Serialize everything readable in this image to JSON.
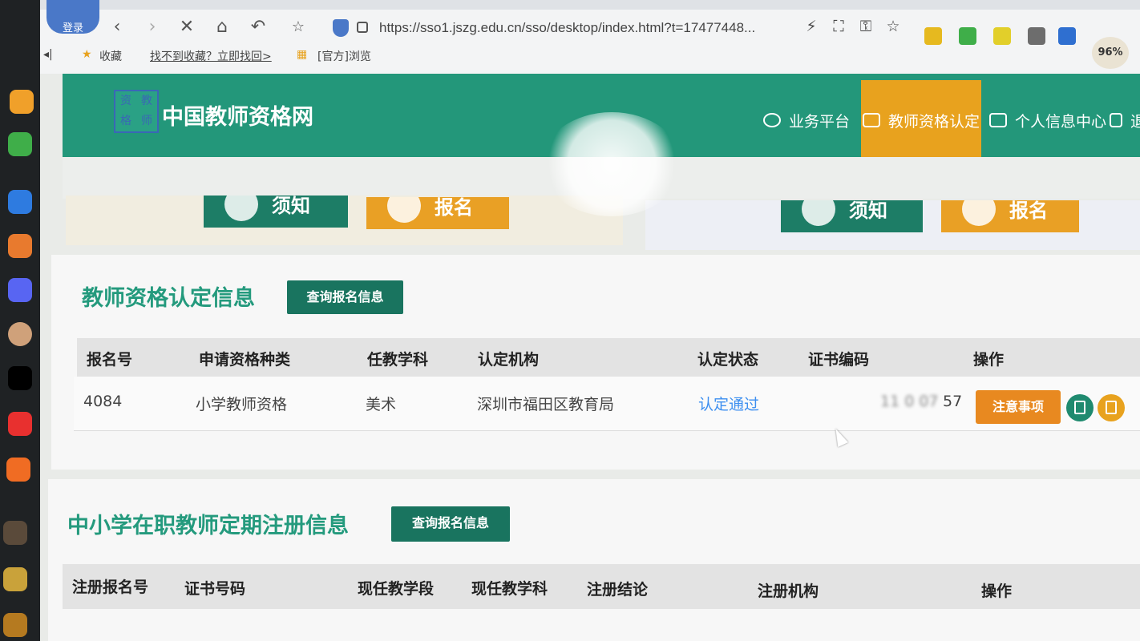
{
  "browser": {
    "login_label": "登录",
    "url": "https://sso1.jszg.edu.cn/sso/desktop/index.html?t=17477448...",
    "zoom_level": "96%",
    "bookmarks": {
      "favorites_label": "收藏",
      "find_favorites_link": "找不到收藏？立即找回>",
      "official_label": "[官方]浏览"
    }
  },
  "site": {
    "logo_chars": [
      "资",
      "教",
      "格",
      "师"
    ],
    "title": "中国教师资格网",
    "nav": {
      "business_platform": "业务平台",
      "teacher_cert": "教师资格认定",
      "personal_center": "个人信息中心",
      "exit_partial": "退"
    },
    "colors": {
      "primary_green": "#23977a",
      "accent_orange": "#e8a21e",
      "dark_green_button": "#19745f",
      "link_blue": "#3d8ff0"
    }
  },
  "quick_cards": [
    {
      "label": "须知",
      "color": "#1d7d66"
    },
    {
      "label": "报名",
      "color": "#e9a025"
    },
    {
      "label": "须知",
      "color": "#1d7d66"
    },
    {
      "label": "报名",
      "color": "#e9a025"
    }
  ],
  "cert_section": {
    "title": "教师资格认定信息",
    "query_button": "查询报名信息",
    "columns": [
      "报名号",
      "申请资格种类",
      "任教学科",
      "认定机构",
      "认定状态",
      "证书编码",
      "操作"
    ],
    "rows": [
      {
        "reg_no": "4084",
        "cert_type": "小学教师资格",
        "subject": "美术",
        "agency": "深圳市福田区教育局",
        "status": "认定通过",
        "cert_code_hidden": "11 0 07",
        "cert_code_tail": "57",
        "notice_button": "注意事项"
      }
    ]
  },
  "registration_section": {
    "title": "中小学在职教师定期注册信息",
    "query_button": "查询报名信息",
    "columns": [
      "注册报名号",
      "证书号码",
      "现任教学段",
      "现任教学科",
      "注册结论",
      "注册机构",
      "操作"
    ]
  }
}
